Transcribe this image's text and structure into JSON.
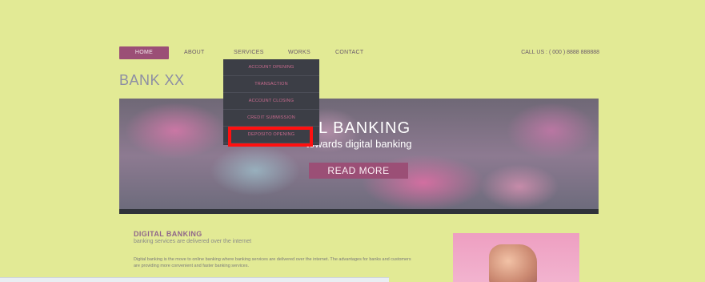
{
  "nav": {
    "home": "HOME",
    "about": "ABOUT",
    "services": "SERVICES",
    "works": "WORKS",
    "contact": "CONTACT",
    "call": "CALL US : ( 000 ) 8888 888888"
  },
  "dropdown": {
    "items": [
      "ACCOUNT OPENING",
      "TRANSACTION",
      "ACCOUNT CLOSING",
      "CREDIT SUBMISSION",
      "DEPOSITO OPENING"
    ]
  },
  "brand": "BANK XX",
  "hero": {
    "title": "AL BANKING",
    "subtitle": "towards digital banking",
    "cta": "READ MORE"
  },
  "content": {
    "title": "DIGITAL BANKING",
    "subtitle": "banking services are delivered over the internet",
    "body": "Digital banking is the move to online banking where banking services are delivered over the internet. The advantages for banks and customers are providing more convenient and faster banking services."
  },
  "colors": {
    "background": "#e2ea95",
    "accent": "#9b4f76",
    "dropdown_bg": "#3c3e46",
    "highlight": "#ff1010"
  }
}
